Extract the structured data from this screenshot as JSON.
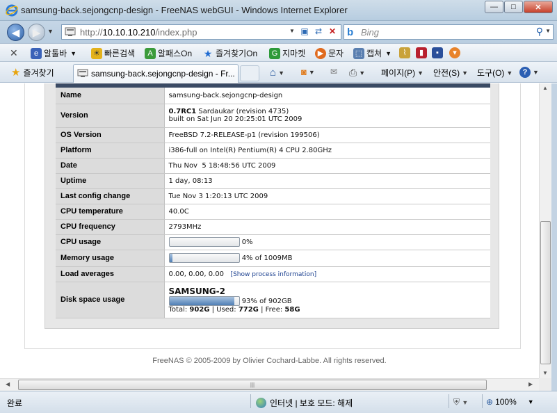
{
  "window": {
    "title": "samsung-back.sejongcnp-design - FreeNAS webGUI - Windows Internet Explorer",
    "min_glyph": "—",
    "max_glyph": "□",
    "close_glyph": "✕"
  },
  "address": {
    "url_prefix": "http://",
    "url_host": "10.10.10.210",
    "url_path": "/index.php",
    "search_placeholder": "Bing"
  },
  "toolbar": {
    "items": [
      "알툴바",
      "빠른검색",
      "알패스On",
      "즐겨찾기On",
      "지마켓",
      "문자",
      "캡쳐"
    ]
  },
  "favorites": {
    "label": "즐겨찾기",
    "tab_title": "samsung-back.sejongcnp-design - Fr...",
    "commands": [
      "페이지(P)",
      "안전(S)",
      "도구(O)"
    ]
  },
  "sysinfo": {
    "name": {
      "label": "Name",
      "value": "samsung-back.sejongcnp-design"
    },
    "version": {
      "label": "Version",
      "number": "0.7RC1",
      "rest": " Sardaukar (revision 4735)",
      "built": "built on Sat Jun 20 20:25:01 UTC 2009"
    },
    "os": {
      "label": "OS Version",
      "value": "FreeBSD 7.2-RELEASE-p1 (revision 199506)"
    },
    "platform": {
      "label": "Platform",
      "value": "i386-full on Intel(R) Pentium(R) 4 CPU 2.80GHz"
    },
    "date": {
      "label": "Date",
      "value": "Thu Nov  5 18:48:56 UTC 2009"
    },
    "uptime": {
      "label": "Uptime",
      "value": "1 day, 08:13"
    },
    "lastconfig": {
      "label": "Last config change",
      "value": "Tue Nov 3 1:20:13 UTC 2009"
    },
    "cputemp": {
      "label": "CPU temperature",
      "value": "40.0C"
    },
    "cpufreq": {
      "label": "CPU frequency",
      "value": "2793MHz"
    },
    "cpuusage": {
      "label": "CPU usage",
      "value": "0%",
      "fraction": 0.0
    },
    "memory": {
      "label": "Memory usage",
      "value": "4% of 1009MB",
      "fraction": 0.04
    },
    "load": {
      "label": "Load averages",
      "value": "0.00, 0.00, 0.00",
      "link": "Show process information",
      "lbracket": "[",
      "rbracket": "]"
    },
    "disk": {
      "label": "Disk space usage",
      "volume": "SAMSUNG-2",
      "usage": "93% of 902GB",
      "fraction": 0.93,
      "total_label": "Total: ",
      "total": "902G",
      "used_label": " | Used: ",
      "used": "772G",
      "free_label": " | Free: ",
      "free": "58G"
    }
  },
  "footer": "FreeNAS © 2005-2009 by Olivier Cochard-Labbe. All rights reserved.",
  "status": {
    "left": "완료",
    "zone": "인터넷 | 보호 모드: 해제",
    "zoom": "100%"
  }
}
